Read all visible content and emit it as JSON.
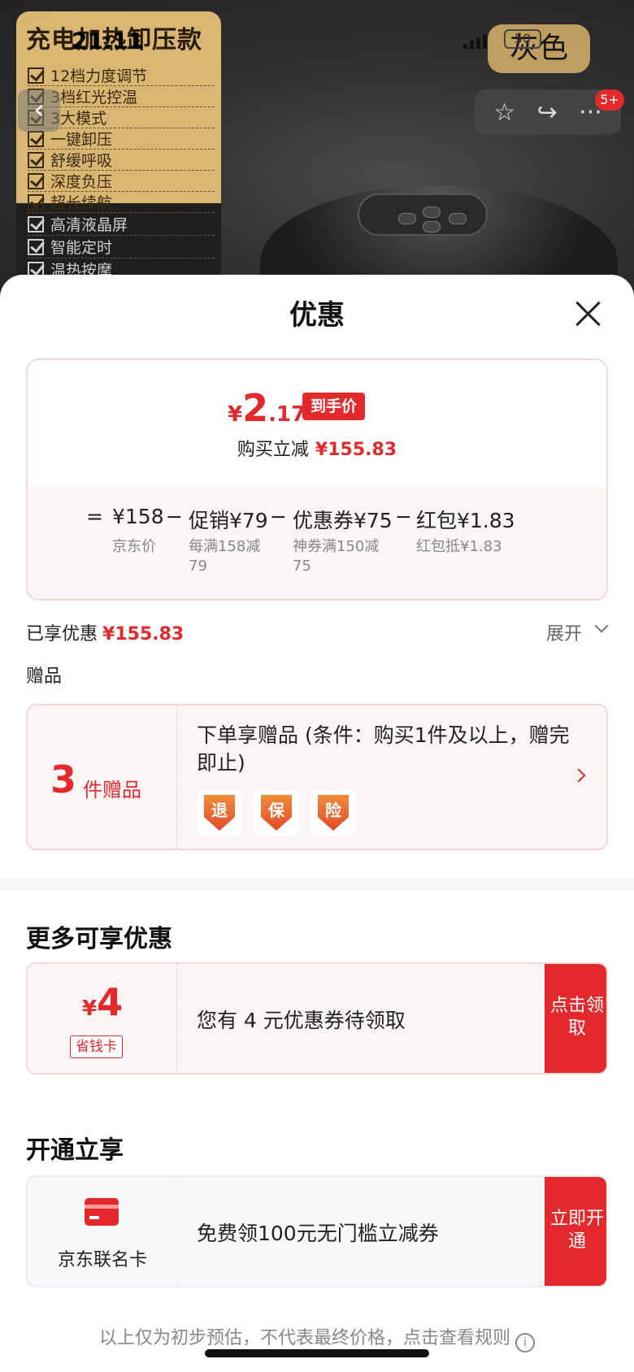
{
  "status_bar": {
    "time": "21:11",
    "battery": "50"
  },
  "product_bg": {
    "promo_title": "充电加热卸压款",
    "features": [
      "12档力度调节",
      "3档红光控温",
      "3大模式",
      "一键卸压",
      "舒缓呼吸",
      "深度负压",
      "超长续航"
    ],
    "features_dark": [
      "高清液晶屏",
      "智能定时",
      "温热按摩"
    ],
    "color_label": "灰色",
    "cart_badge": "5+"
  },
  "sheet": {
    "title": "优惠",
    "price": {
      "currency": "¥",
      "integer": "2",
      "decimal": ".17",
      "tag": "到手价",
      "save_label": "购买立减",
      "save_value": "¥155.83"
    },
    "formula": {
      "equals": "=",
      "minus": "−",
      "items": [
        {
          "label": "¥158",
          "sub": "京东价"
        },
        {
          "label": "促销¥79",
          "sub": "每满158减79"
        },
        {
          "label": "优惠券¥75",
          "sub": "神券满150减75"
        },
        {
          "label": "红包¥1.83",
          "sub": "红包抵¥1.83"
        }
      ]
    },
    "enjoyed_label": "已享优惠",
    "enjoyed_value": "¥155.83",
    "expand_label": "展开",
    "gift_section_label": "赠品",
    "gift": {
      "count": "3",
      "unit": "件赠品",
      "desc": "下单享赠品 (条件：购买1件及以上，赠完即止)",
      "icons": [
        "退",
        "保",
        "险"
      ]
    },
    "more_title": "更多可享优惠",
    "coupon": {
      "currency": "¥",
      "amount": "4",
      "tag": "省钱卡",
      "desc": "您有 4 元优惠券待领取",
      "button": "点击领取"
    },
    "open_title": "开通立享",
    "card": {
      "name": "京东联名卡",
      "desc": "免费领100元无门槛立减券",
      "button": "立即开通"
    },
    "disclaimer": "以上仅为初步预估，不代表最终价格，点击查看规则"
  }
}
